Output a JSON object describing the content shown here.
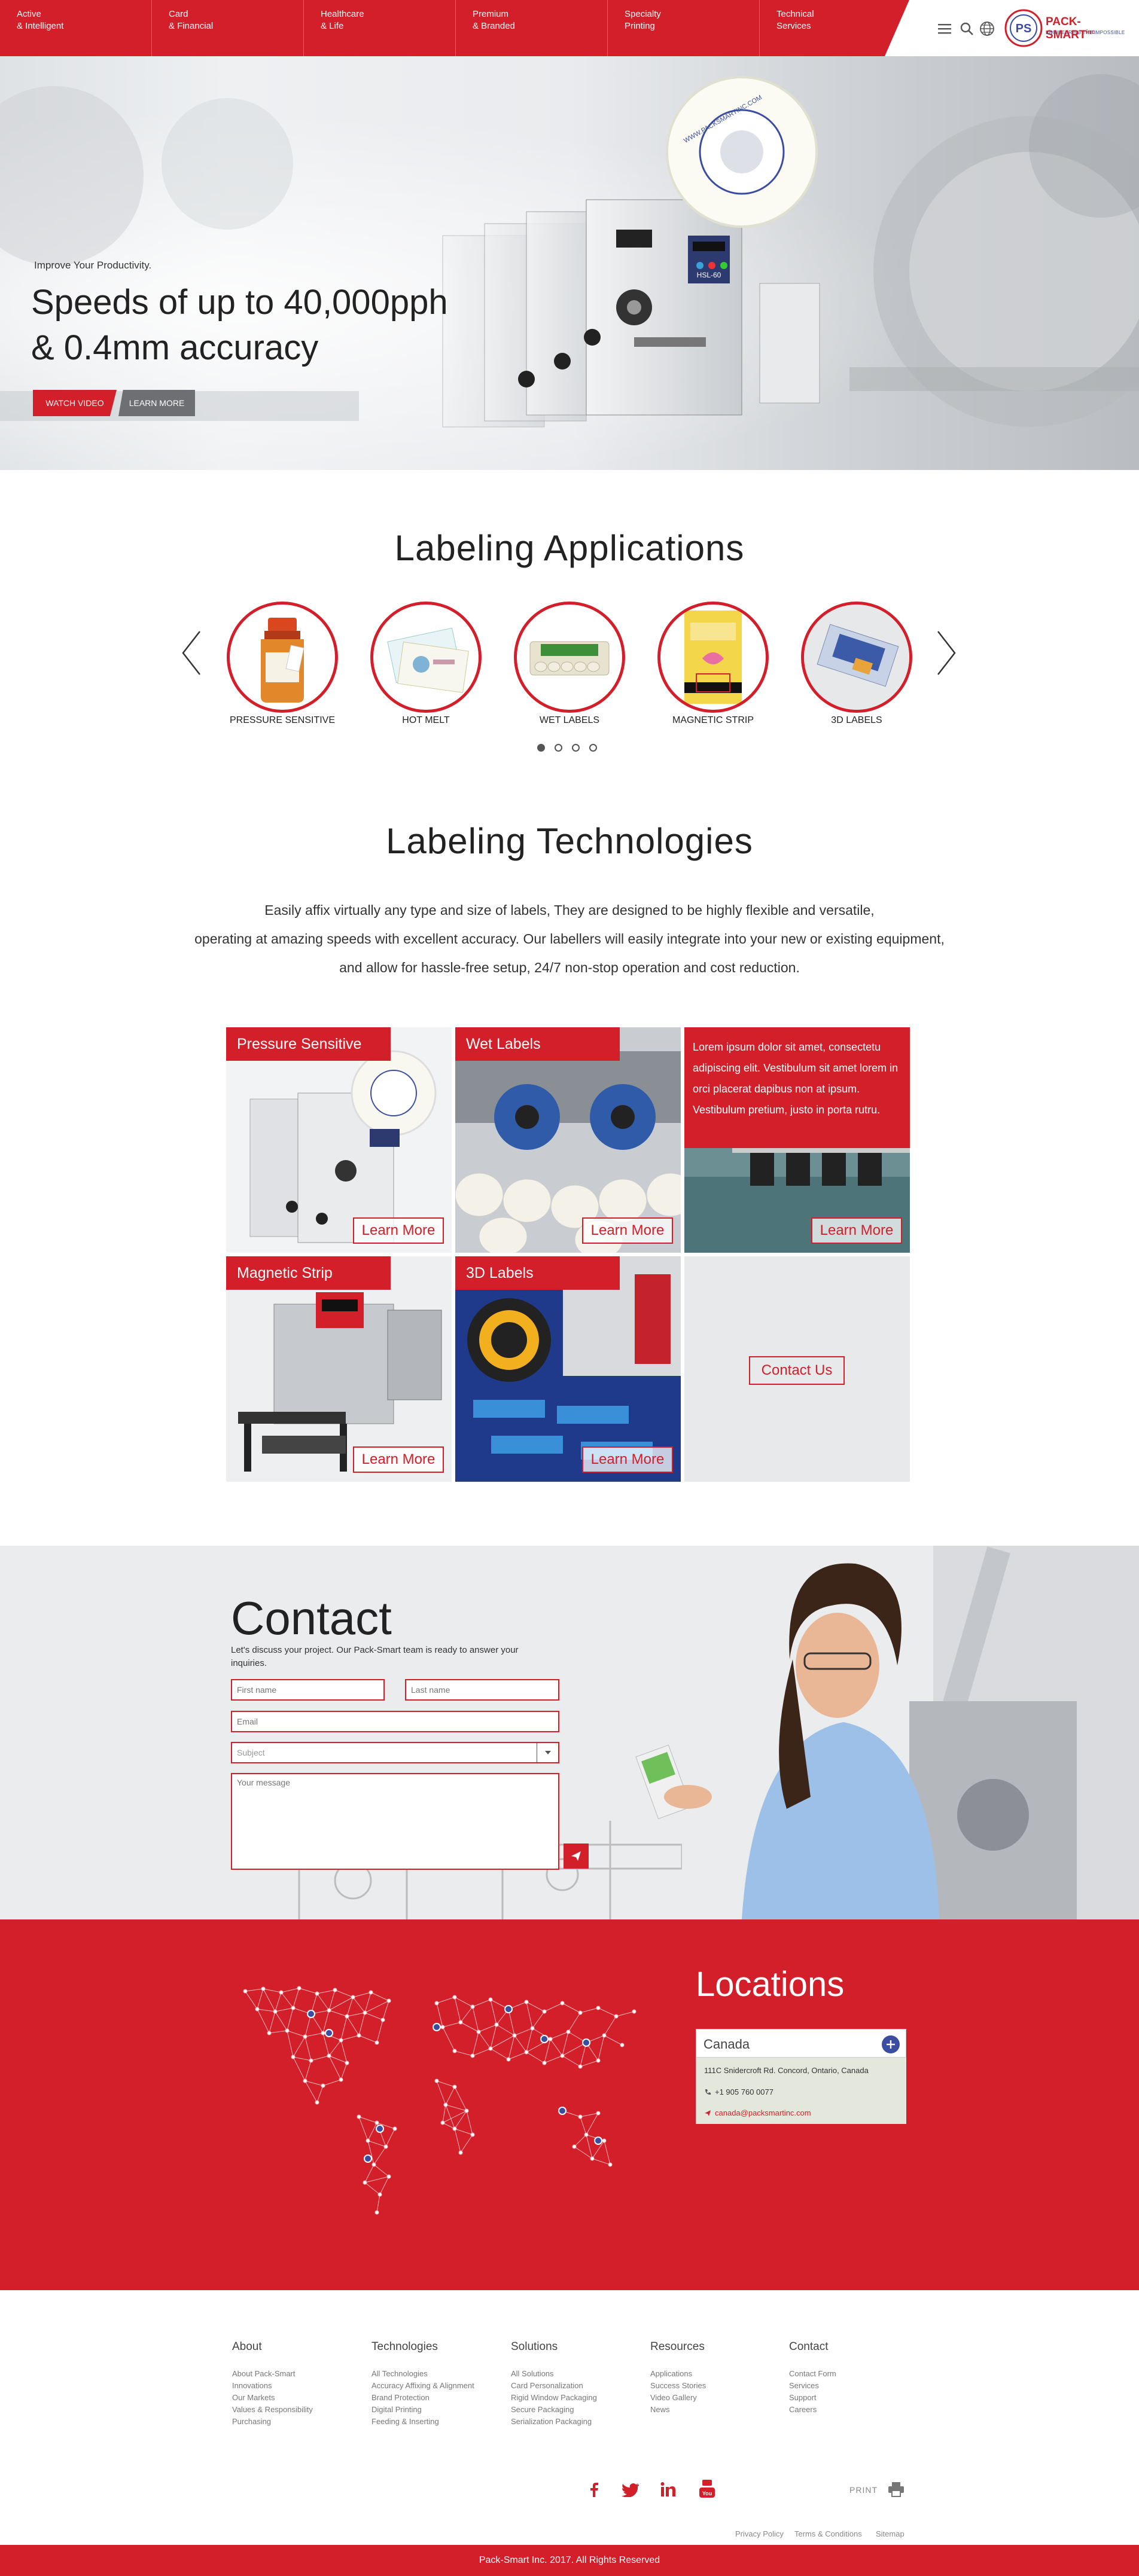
{
  "nav": {
    "items": [
      {
        "line1": "Active",
        "line2": "& Intelligent"
      },
      {
        "line1": "Card",
        "line2": "& Financial"
      },
      {
        "line1": "Healthcare",
        "line2": "& Life"
      },
      {
        "line1": "Premium",
        "line2": "& Branded"
      },
      {
        "line1": "Specialty",
        "line2": "Printing"
      },
      {
        "line1": "Technical",
        "line2": "Services"
      }
    ],
    "logo_name": "PACK-SMART",
    "logo_sup": "inc",
    "logo_tagline": "ENGINEERING THE IMPOSSIBLE",
    "icons": [
      "menu-icon",
      "search-icon",
      "globe-icon"
    ]
  },
  "hero": {
    "subtitle": "Improve Your Productivity.",
    "title_line1": "Speeds of up to 40,000pph",
    "title_line2": "& 0.4mm accuracy",
    "watch_label": "WATCH VIDEO",
    "learn_label": "LEARN MORE",
    "machine_label": "HSL-60",
    "reel_text": "WWW.PACKSMARTINC.COM"
  },
  "applications": {
    "title": "Labeling Applications",
    "items": [
      {
        "label": "PRESSURE SENSITIVE"
      },
      {
        "label": "HOT MELT"
      },
      {
        "label": "WET LABELS"
      },
      {
        "label": "MAGNETIC STRIP"
      },
      {
        "label": "3D LABELS"
      }
    ],
    "dots": 4,
    "active_dot": 0
  },
  "technologies": {
    "title": "Labeling Technologies",
    "para_line1": "Easily affix virtually any type and size of labels, They are designed to be highly flexible and versatile,",
    "para_line2": "operating at amazing speeds with excellent accuracy. Our labellers will easily integrate into your new or existing equipment,",
    "para_line3": "and allow for hassle-free setup, 24/7 non-stop operation and cost reduction.",
    "tiles": [
      {
        "label": "Pressure Sensitive",
        "cta": "Learn More"
      },
      {
        "label": "Wet Labels",
        "cta": "Learn More"
      },
      {
        "label": "",
        "cta": "Learn More",
        "overlay_text": "Lorem ipsum dolor sit amet, consectetu adipiscing elit. Vestibulum sit amet lorem in orci placerat dapibus non at ipsum. Vestibulum pretium, justo in porta rutru."
      },
      {
        "label": "Magnetic Strip",
        "cta": "Learn More"
      },
      {
        "label": "3D Labels",
        "cta": "Learn More"
      },
      {
        "label": "",
        "cta": "Contact Us"
      }
    ]
  },
  "contact": {
    "title": "Contact",
    "subtitle_line1": "Let's discuss your project. Our Pack-Smart team is ready to answer your",
    "subtitle_line2": "inquiries.",
    "first_name_ph": "First name",
    "last_name_ph": "Last name",
    "email_ph": "Email",
    "subject_ph": "Subject",
    "message_ph": "Your message"
  },
  "locations": {
    "title": "Locations",
    "selected": "Canada",
    "address": "111C Snidercroft Rd. Concord, Ontario, Canada",
    "phone": "+1 905 760 0077",
    "email": "canada@packsmartinc.com"
  },
  "footer": {
    "columns": [
      {
        "title": "About",
        "links": [
          "About Pack-Smart",
          "Innovations",
          "Our Markets",
          "Values & Responsibility",
          "Purchasing"
        ]
      },
      {
        "title": "Technologies",
        "links": [
          "All Technologies",
          "Accuracy Affixing & Alignment",
          "Brand Protection",
          "Digital Printing",
          "Feeding & Inserting"
        ]
      },
      {
        "title": "Solutions",
        "links": [
          "All Solutions",
          "Card Personalization",
          "Rigid Window Packaging",
          "Secure Packaging",
          "Serialization Packaging"
        ]
      },
      {
        "title": "Resources",
        "links": [
          "Applications",
          "Success Stories",
          "Video Gallery",
          "News"
        ]
      },
      {
        "title": "Contact",
        "links": [
          "Contact Form",
          "Services",
          "Support",
          "Careers"
        ]
      }
    ],
    "social": [
      "facebook-icon",
      "twitter-icon",
      "linkedin-icon",
      "youtube-icon"
    ],
    "print_label": "PRINT",
    "legal": [
      "Privacy Policy",
      "Terms & Conditions",
      "Sitemap"
    ],
    "copyright": "Pack-Smart Inc. 2017. All Rights Reserved"
  },
  "colors": {
    "brand_red": "#d31f2a",
    "dark_text": "#222222",
    "grey_bg": "#ebecee"
  }
}
